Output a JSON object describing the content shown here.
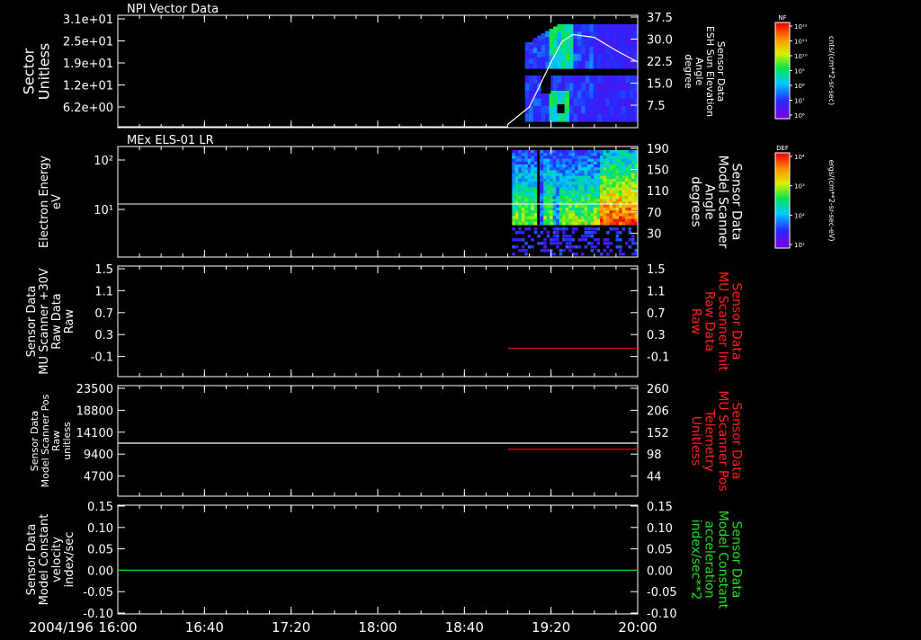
{
  "chart_data": {
    "type": "stacked-panels",
    "date_label": "2004/196",
    "x_ticks": [
      "16:00",
      "16:40",
      "17:20",
      "18:00",
      "18:40",
      "19:20",
      "20:00"
    ],
    "x_range": [
      "16:00",
      "20:00"
    ],
    "panels": [
      {
        "id": "p1",
        "title": "NPI Vector Data",
        "type": "spectrogram",
        "left_label": [
          "Sector",
          "Unitless"
        ],
        "left_ticks": [
          "3.1e+01",
          "2.5e+01",
          "1.9e+01",
          "1.2e+01",
          "6.2e+00"
        ],
        "right_label": [
          "Sensor Data",
          "ESH Sun Elevation",
          "Angle",
          "degree"
        ],
        "right_ticks": [
          "37.5",
          "30.0",
          "22.5",
          "15.0",
          "7.5"
        ],
        "right_label_color": "#ffffff",
        "data_start": "19:08",
        "line_series": {
          "name": "ESH Sun Elevation Angle",
          "color": "#ffffff",
          "x": [
            "19:00",
            "19:10",
            "19:20",
            "19:25",
            "19:30",
            "19:40",
            "19:50",
            "20:00"
          ],
          "y": [
            0.5,
            6.5,
            22.0,
            29.0,
            31.5,
            30.5,
            26.0,
            22.0
          ]
        },
        "colorbar": {
          "label": "NF",
          "units": "cnts/(cm**2-sr-sec)",
          "ticks": [
            "10¹²",
            "10¹¹",
            "10¹⁰",
            "10⁹",
            "10⁸",
            "10⁷",
            "10⁶"
          ]
        }
      },
      {
        "id": "p2",
        "title": "MEx ELS-01 LR",
        "type": "spectrogram",
        "left_label": [
          "Electron Energy",
          "eV"
        ],
        "left_ticks": [
          "10²",
          "10¹"
        ],
        "right_label": [
          "Sensor Data",
          "Model Scanner",
          "Angle",
          "degrees"
        ],
        "right_ticks": [
          "190",
          "150",
          "110",
          "70",
          "30"
        ],
        "right_label_color": "#ffffff",
        "data_start": "19:02",
        "line_series": {
          "name": "Model Scanner Angle",
          "color": "#ffffff",
          "x": [
            "16:00",
            "20:00"
          ],
          "y": [
            85,
            85
          ]
        },
        "colorbar": {
          "label": "DEF",
          "units": "ergs/(cm**2-sr-sec-eV)",
          "ticks": [
            "10⁴",
            "10³",
            "10²",
            "10¹"
          ]
        }
      },
      {
        "id": "p3",
        "type": "line",
        "left_label": [
          "Sensor Data",
          "MU Scanner +30V",
          "Raw Data",
          "Raw"
        ],
        "left_ticks": [
          "1.5",
          "1.1",
          "0.7",
          "0.3",
          "-0.1"
        ],
        "right_label": [
          "Sensor Data",
          "MU Scanner Init",
          "Raw Data",
          "Raw"
        ],
        "right_ticks": [
          "1.5",
          "1.1",
          "0.7",
          "0.3",
          "-0.1"
        ],
        "right_label_color": "#ff2020",
        "ylim": [
          -0.3,
          1.5
        ],
        "series": [
          {
            "name": "MU Scanner Init Raw Data",
            "color": "#cc1111",
            "axis": "right",
            "x": [
              "19:00",
              "20:00"
            ],
            "y": [
              0.0,
              0.0
            ]
          }
        ]
      },
      {
        "id": "p4",
        "type": "line",
        "left_label": [
          "Sensor Data",
          "Model Scanner Pos",
          "Raw",
          "unitless"
        ],
        "left_ticks": [
          "23500",
          "18800",
          "14100",
          "9400",
          "4700"
        ],
        "right_label": [
          "Sensor Data",
          "MU Scanner Pos",
          "Telemetry",
          "Unitless"
        ],
        "right_ticks": [
          "260",
          "206",
          "152",
          "98",
          "44"
        ],
        "right_label_color": "#ff2020",
        "ylim_left": [
          0,
          23500
        ],
        "ylim_right": [
          0,
          260
        ],
        "series": [
          {
            "name": "Model Scanner Pos",
            "color": "#ffffff",
            "axis": "left",
            "x": [
              "16:00",
              "20:00"
            ],
            "y": [
              11750,
              11750
            ]
          },
          {
            "name": "MU Scanner Pos Telemetry",
            "color": "#cc1111",
            "axis": "right",
            "x": [
              "19:00",
              "20:00"
            ],
            "y": [
              110,
              110
            ]
          }
        ]
      },
      {
        "id": "p5",
        "type": "line",
        "left_label": [
          "Sensor Data",
          "Model Constant",
          "velocity",
          "index/sec"
        ],
        "left_ticks": [
          "0.15",
          "0.10",
          "0.05",
          "0.00",
          "-0.05",
          "-0.10"
        ],
        "right_label": [
          "Sensor Data",
          "Model Constant",
          "acceleration",
          "index/sec**2"
        ],
        "right_ticks": [
          "0.15",
          "0.10",
          "0.05",
          "0.00",
          "-0.05",
          "-0.10"
        ],
        "right_label_color": "#22dd22",
        "ylim": [
          -0.1,
          0.15
        ],
        "series": [
          {
            "name": "Model Constant acceleration",
            "color": "#22cc22",
            "axis": "right",
            "x": [
              "16:00",
              "20:00"
            ],
            "y": [
              0.0,
              0.0
            ]
          }
        ]
      }
    ]
  }
}
